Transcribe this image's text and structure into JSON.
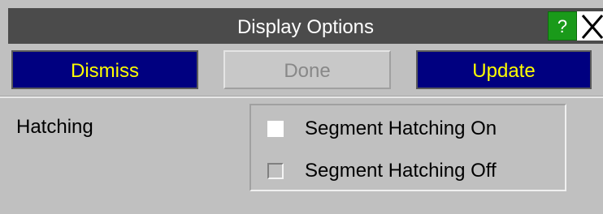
{
  "window": {
    "title": "Display Options",
    "help_label": "?",
    "colors": {
      "titlebar": "#4b4b4b",
      "button_bg": "#000080",
      "button_text": "#ffff00",
      "help_bg": "#1a9a1a",
      "panel_bg": "#c0c0c0"
    }
  },
  "toolbar": {
    "dismiss_label": "Dismiss",
    "done_label": "Done",
    "update_label": "Update"
  },
  "hatching": {
    "label": "Hatching",
    "options": [
      {
        "label": "Segment Hatching On",
        "selected": true
      },
      {
        "label": "Segment Hatching Off",
        "selected": false
      }
    ]
  }
}
